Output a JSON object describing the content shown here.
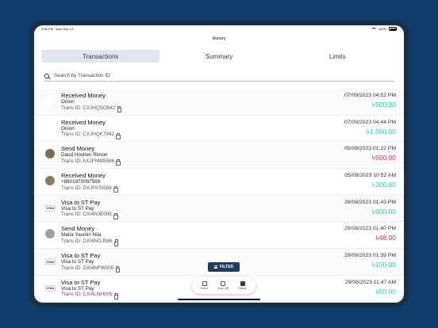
{
  "status_bar": {
    "time": "3:06 PM",
    "date": "Wed Sep 13",
    "battery": "100%"
  },
  "navbar": {
    "title": "History"
  },
  "tabs": [
    {
      "label": "Transactions",
      "active": true
    },
    {
      "label": "Summary",
      "active": false
    },
    {
      "label": "Limits",
      "active": false
    }
  ],
  "search": {
    "placeholder": "Search by Transaction ID",
    "icon": "search-icon"
  },
  "colors": {
    "credit": "#1fd1a8",
    "debit": "#e0285a",
    "accent": "#1f3d5e"
  },
  "transactions": [
    {
      "title": "Received Money",
      "subtitle": "Onion",
      "trans_id": "Trans ID: CXJHQSO942",
      "date": "07/09/2023 04:52 PM",
      "amount": "৳500.00",
      "type": "credit",
      "avatar": "female"
    },
    {
      "title": "Received Money",
      "subtitle": "Onion",
      "trans_id": "Trans ID: CXJHQK7942",
      "date": "07/09/2023 04:44 PM",
      "amount": "৳1,500.00",
      "type": "credit",
      "avatar": "female"
    },
    {
      "title": "Send Money",
      "subtitle": "Daud Hoshen Rimon",
      "trans_id": "Trans ID: AXJFNW6586",
      "date": "05/09/2023 01:22 PM",
      "amount": "৳500.00",
      "type": "debit",
      "avatar": "male1"
    },
    {
      "title": "Received Money",
      "subtitle": "+8801970097589",
      "trans_id": "Trans ID: DXJFKSI589",
      "date": "05/09/2023 10:52 AM",
      "amount": "৳200.00",
      "type": "credit",
      "avatar": "male2"
    },
    {
      "title": "Visa to ST Pay",
      "subtitle": "Visa to ST Pay",
      "trans_id": "Trans ID: CXI4NJE005",
      "date": "29/08/2023 01:43 PM",
      "amount": "৳500.00",
      "type": "credit",
      "avatar": "visa"
    },
    {
      "title": "Send Money",
      "subtitle": "Maria Yasmin Nila",
      "trans_id": "Trans ID: DXI4NGJ586",
      "date": "29/08/2023 01:40 PM",
      "amount": "৳48.00",
      "type": "debit",
      "avatar": "male3"
    },
    {
      "title": "Visa to ST Pay",
      "subtitle": "Visa to ST Pay",
      "trans_id": "Trans ID: DXI4NFW005",
      "date": "29/08/2023 01:39 PM",
      "amount": "৳150.00",
      "type": "credit",
      "avatar": "visa"
    },
    {
      "title": "Visa to ST Pay",
      "subtitle": "Visa to ST Pay",
      "trans_id": "Trans ID: CXI4LNH005",
      "date": "29/08/2023 11:47 AM",
      "amount": "৳50.00",
      "type": "credit",
      "avatar": "visa"
    }
  ],
  "filter_button": {
    "label": "FILTER"
  },
  "bottom_nav": [
    {
      "label": "Home",
      "icon": "home-icon",
      "active": false
    },
    {
      "label": "Scan QR",
      "icon": "qr-icon",
      "active": false
    },
    {
      "label": "History",
      "icon": "history-icon",
      "active": true
    }
  ]
}
